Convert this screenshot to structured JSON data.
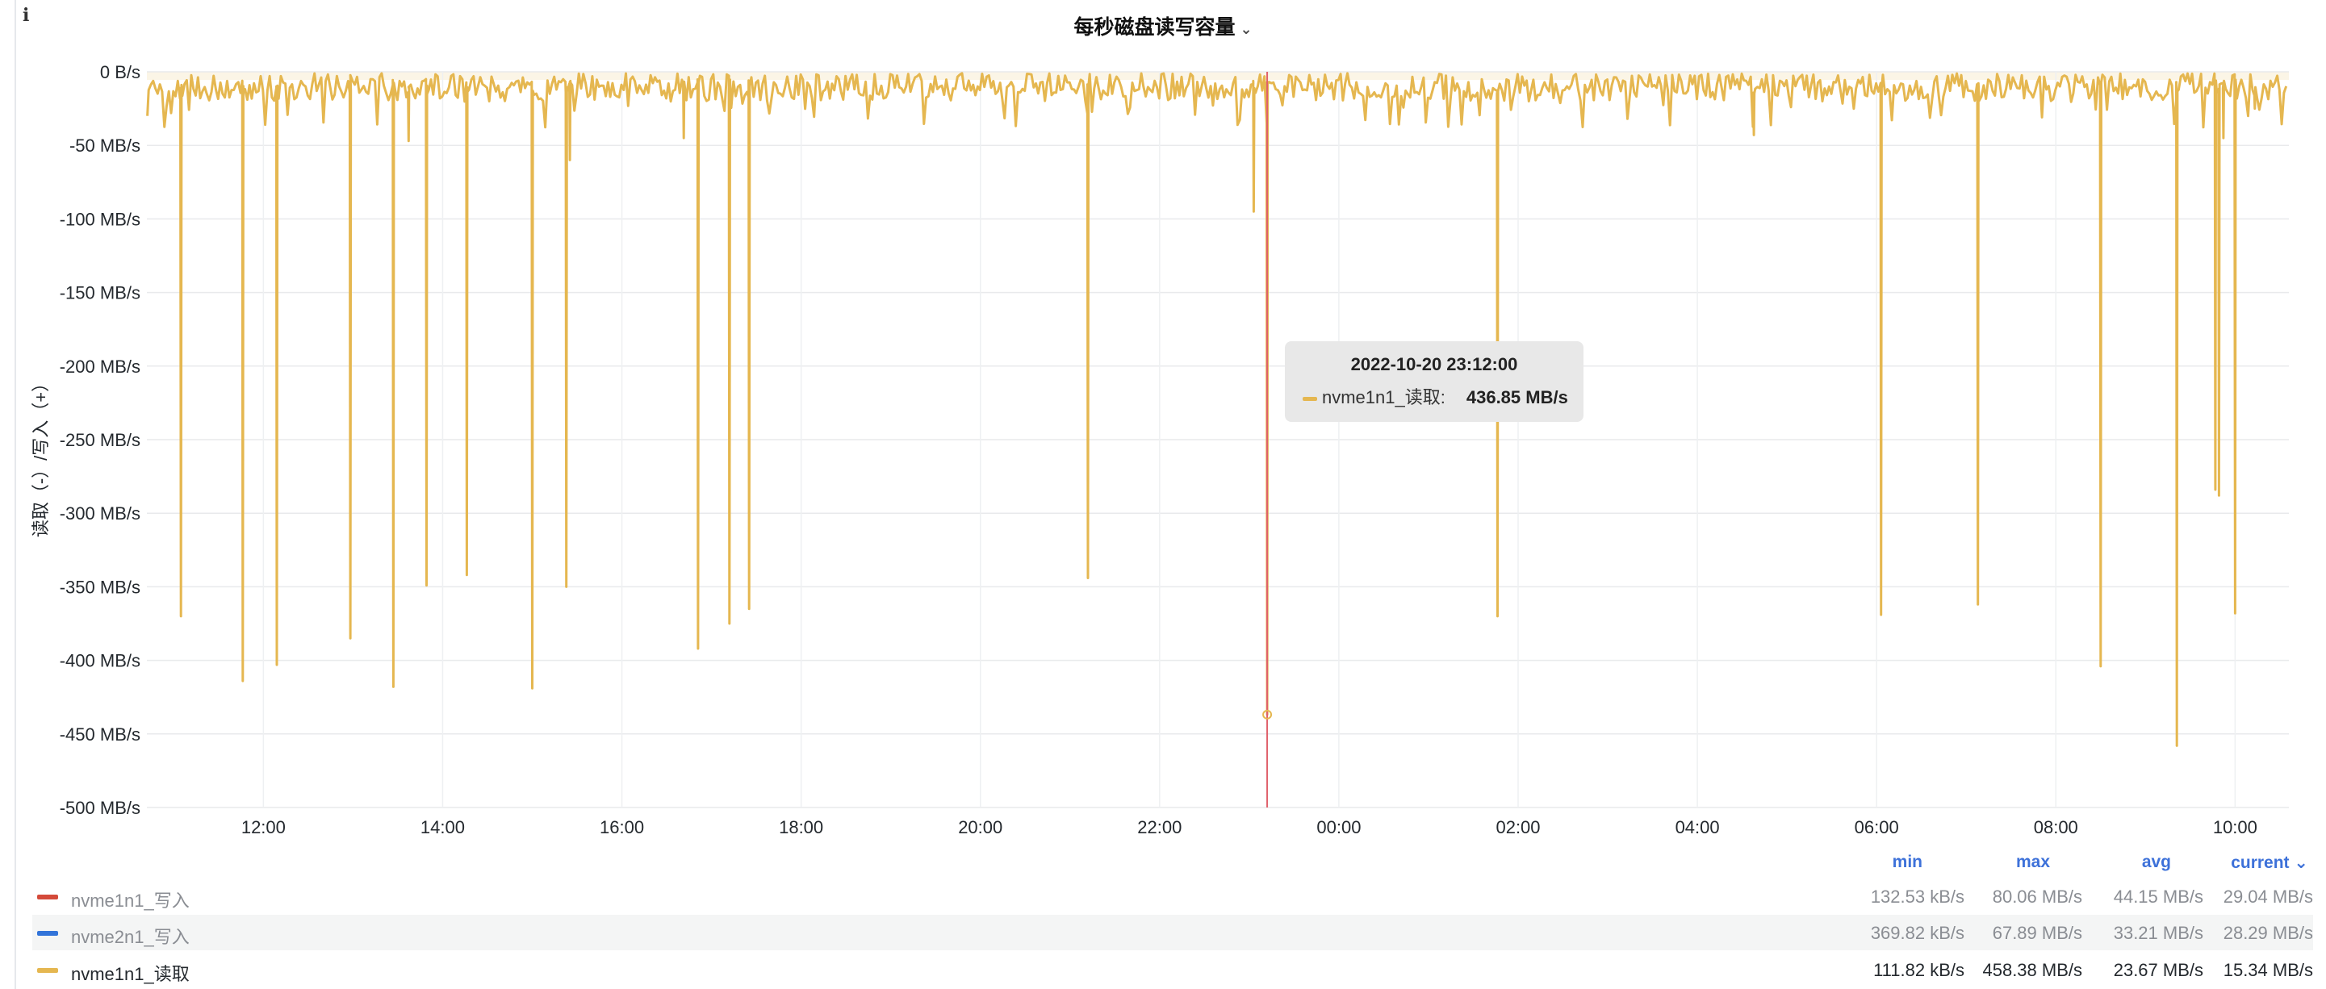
{
  "panel": {
    "title": "每秒磁盘读写容量",
    "title_chevron": "⌄",
    "info_icon": "i"
  },
  "chart_data": {
    "type": "line",
    "ylabel": "读取（-）/写入（+）",
    "y_ticks": [
      "0 B/s",
      "-50 MB/s",
      "-100 MB/s",
      "-150 MB/s",
      "-200 MB/s",
      "-250 MB/s",
      "-300 MB/s",
      "-350 MB/s",
      "-400 MB/s",
      "-450 MB/s",
      "-500 MB/s"
    ],
    "x_ticks": [
      "12:00",
      "14:00",
      "16:00",
      "18:00",
      "20:00",
      "22:00",
      "00:00",
      "02:00",
      "04:00",
      "06:00",
      "08:00",
      "10:00"
    ],
    "ylim": [
      -500,
      0
    ],
    "x_range_hours": [
      10.7,
      34.6
    ],
    "baseline_mb_s": [
      -5,
      -20
    ],
    "series": [
      {
        "name": "nvme1n1_读取",
        "color": "#e5b750",
        "spikes": [
          {
            "t": 11.08,
            "v": -370
          },
          {
            "t": 11.77,
            "v": -414
          },
          {
            "t": 12.15,
            "v": -403
          },
          {
            "t": 12.97,
            "v": -385
          },
          {
            "t": 13.45,
            "v": -418
          },
          {
            "t": 13.62,
            "v": -47
          },
          {
            "t": 13.82,
            "v": -349
          },
          {
            "t": 14.27,
            "v": -342
          },
          {
            "t": 15.0,
            "v": -419
          },
          {
            "t": 15.38,
            "v": -350
          },
          {
            "t": 15.42,
            "v": -60
          },
          {
            "t": 16.69,
            "v": -45
          },
          {
            "t": 16.85,
            "v": -392
          },
          {
            "t": 17.2,
            "v": -375
          },
          {
            "t": 17.42,
            "v": -365
          },
          {
            "t": 21.2,
            "v": -344
          },
          {
            "t": 23.05,
            "v": -95
          },
          {
            "t": 23.2,
            "v": -436.85
          },
          {
            "t": 25.77,
            "v": -370
          },
          {
            "t": 28.63,
            "v": -43
          },
          {
            "t": 30.05,
            "v": -369
          },
          {
            "t": 31.13,
            "v": -362
          },
          {
            "t": 32.5,
            "v": -404
          },
          {
            "t": 33.35,
            "v": -458
          },
          {
            "t": 33.78,
            "v": -284
          },
          {
            "t": 33.82,
            "v": -288
          },
          {
            "t": 33.87,
            "v": -45
          },
          {
            "t": 34.0,
            "v": -368
          },
          {
            "t": 34.22,
            "v": -25
          }
        ]
      }
    ],
    "hover_marker": {
      "time": "2022-10-20 23:12:00",
      "value": -436.85
    }
  },
  "tooltip": {
    "time": "2022-10-20 23:12:00",
    "series_name": "nvme1n1_读取:",
    "value": "436.85 MB/s"
  },
  "legend": {
    "headers": {
      "min": "min",
      "max": "max",
      "avg": "avg",
      "current": "current ⌄"
    },
    "rows": [
      {
        "name": "nvme1n1_写入",
        "color": "#d44a3a",
        "min": "132.53 kB/s",
        "max": "80.06 MB/s",
        "avg": "44.15 MB/s",
        "current": "29.04 MB/s"
      },
      {
        "name": "nvme2n1_写入",
        "color": "#3274d9",
        "min": "369.82 kB/s",
        "max": "67.89 MB/s",
        "avg": "33.21 MB/s",
        "current": "28.29 MB/s"
      },
      {
        "name": "nvme1n1_读取",
        "color": "#e5b750",
        "min": "111.82 kB/s",
        "max": "458.38 MB/s",
        "avg": "23.67 MB/s",
        "current": "15.34 MB/s"
      }
    ]
  }
}
